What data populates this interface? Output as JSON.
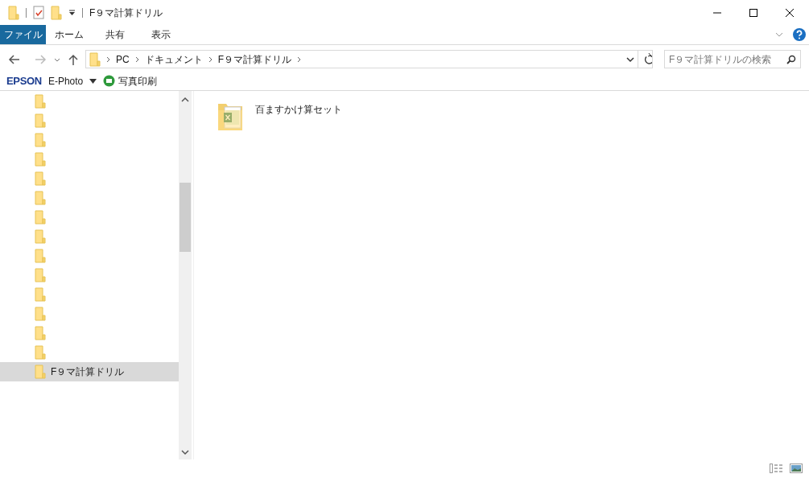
{
  "window": {
    "title": "F９マ計算ドリル"
  },
  "ribbon_tabs": [
    {
      "label": "ファイル",
      "selected": true
    },
    {
      "label": "ホーム",
      "selected": false
    },
    {
      "label": "共有",
      "selected": false
    },
    {
      "label": "表示",
      "selected": false
    }
  ],
  "address": {
    "crumbs": [
      "PC",
      "ドキュメント",
      "F９マ計算ドリル"
    ]
  },
  "search": {
    "placeholder": "F９マ計算ドリルの検索"
  },
  "toolbar": {
    "brand": "EPSON",
    "app": "E-Photo",
    "action": "写真印刷"
  },
  "nav_items": [
    {
      "selected": false
    },
    {
      "selected": false
    },
    {
      "selected": false
    },
    {
      "selected": false
    },
    {
      "selected": false
    },
    {
      "selected": false
    },
    {
      "selected": false
    },
    {
      "selected": false
    },
    {
      "selected": false
    },
    {
      "selected": false
    },
    {
      "selected": false
    },
    {
      "selected": false
    },
    {
      "selected": false
    },
    {
      "selected": false
    },
    {
      "label": "F９マ計算ドリル",
      "selected": true
    }
  ],
  "files": [
    {
      "name": "百ますかけ算セット",
      "kind": "excel-folder"
    }
  ]
}
